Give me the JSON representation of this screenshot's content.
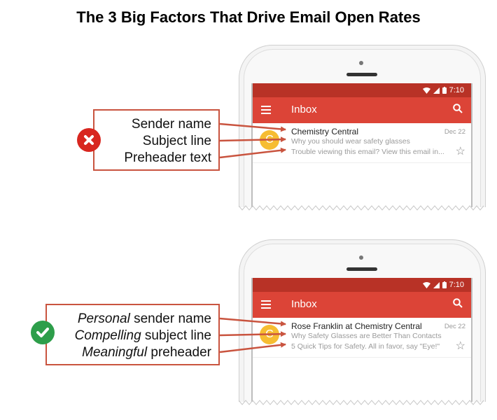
{
  "title": "The 3 Big Factors That Drive Email Open Rates",
  "colors": {
    "status_bar": "#b83226",
    "app_bar": "#dc4437",
    "callout_border": "#c9543f",
    "arrow": "#c9543f",
    "avatar": "#f6bd32",
    "bad_badge": "#d8261f",
    "good_badge": "#2d9e4a"
  },
  "examples": [
    {
      "verdict": "bad",
      "badge_icon": "x-mark-icon",
      "callout": [
        {
          "emphasis": "",
          "text": "Sender name"
        },
        {
          "emphasis": "",
          "text": "Subject line"
        },
        {
          "emphasis": "",
          "text": "Preheader text"
        }
      ],
      "phone": {
        "status_time": "7:10",
        "app_title": "Inbox",
        "email": {
          "avatar_letter": "C",
          "sender": "Chemistry Central",
          "subject": "Why you should wear safety glasses",
          "preheader": "Trouble viewing this email? View this email in...",
          "date": "Dec 22"
        }
      }
    },
    {
      "verdict": "good",
      "badge_icon": "check-mark-icon",
      "callout": [
        {
          "emphasis": "Personal",
          "text": " sender name"
        },
        {
          "emphasis": "Compelling",
          "text": " subject line"
        },
        {
          "emphasis": "Meaningful",
          "text": " preheader"
        }
      ],
      "phone": {
        "status_time": "7:10",
        "app_title": "Inbox",
        "email": {
          "avatar_letter": "C",
          "sender": "Rose Franklin at Chemistry Central",
          "subject": "Why Safety Glasses are Better Than Contacts",
          "preheader": "5 Quick Tips for Safety. All in favor, say \"Eye!\"",
          "date": "Dec 22"
        }
      }
    }
  ]
}
